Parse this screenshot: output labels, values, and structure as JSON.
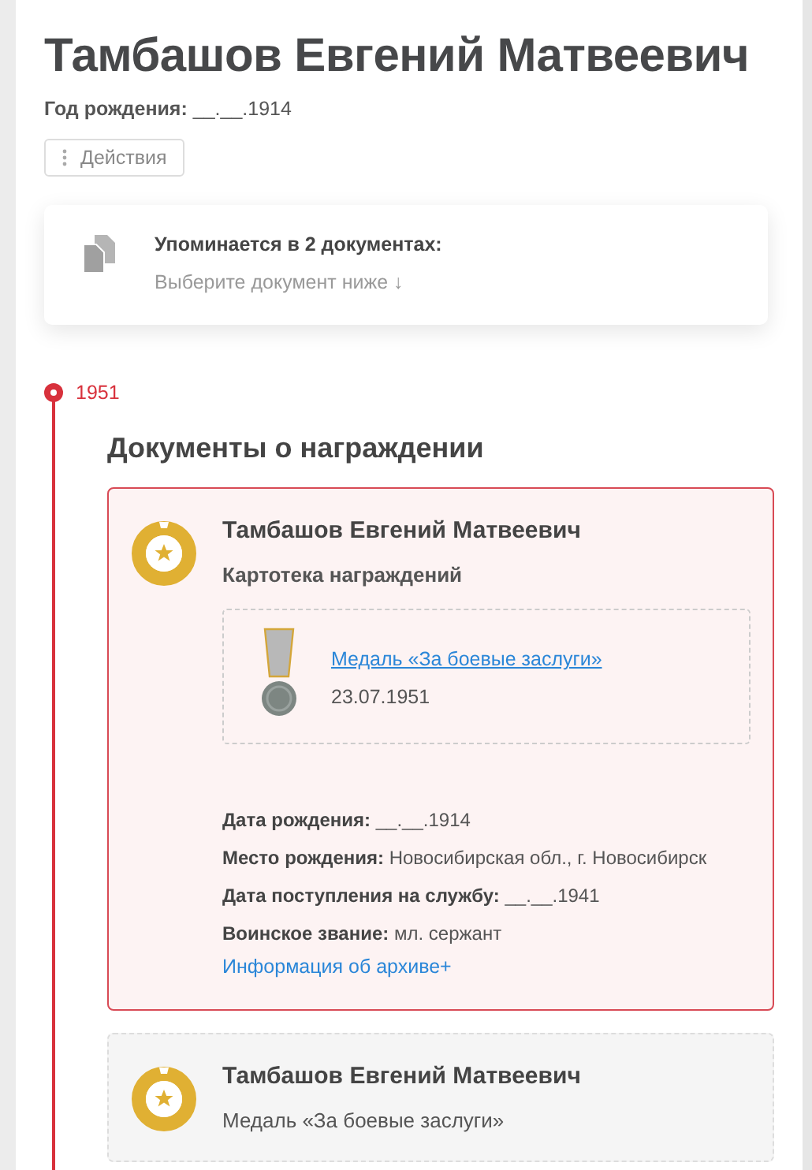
{
  "person": {
    "name": "Тамбашов Евгений Матвеевич",
    "birth_label": "Год рождения:",
    "birth_value": "__.__.1914"
  },
  "actions_button": {
    "label": "Действия"
  },
  "mentions": {
    "title": "Упоминается в 2 документах:",
    "hint": "Выберите документ ниже",
    "arrow": "↓"
  },
  "timeline": [
    {
      "year": "1951",
      "section_title": "Документы о награждении",
      "documents": [
        {
          "kind": "card_file",
          "selected": true,
          "name": "Тамбашов Евгений Матвеевич",
          "subtitle": "Картотека награждений",
          "award": {
            "link": "Медаль «За боевые заслуги»",
            "date": "23.07.1951"
          },
          "fields": [
            {
              "label": "Дата рождения:",
              "value": "__.__.1914"
            },
            {
              "label": "Место рождения:",
              "value": "Новосибирская обл., г. Новосибирск"
            },
            {
              "label": "Дата поступления на службу:",
              "value": "__.__.1941"
            },
            {
              "label": "Воинское звание:",
              "value": "мл. сержант"
            }
          ],
          "archive_link": "Информация об архиве+"
        },
        {
          "kind": "medal",
          "selected": false,
          "name": "Тамбашов Евгений Матвеевич",
          "subtitle": "Медаль «За боевые заслуги»"
        }
      ]
    }
  ]
}
